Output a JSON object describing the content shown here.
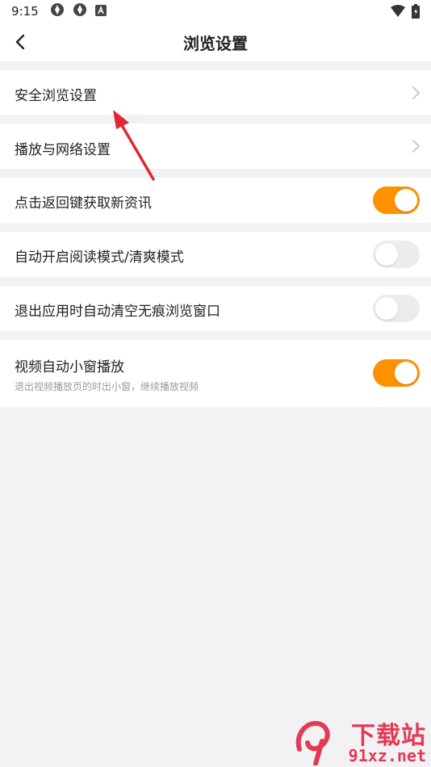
{
  "status_bar": {
    "time": "9:15",
    "icons": [
      "sync-icon",
      "sync-icon",
      "a-icon",
      "wifi-icon",
      "battery-icon"
    ]
  },
  "header": {
    "title": "浏览设置",
    "back_icon": "back-arrow-icon"
  },
  "settings": {
    "safe_browsing": {
      "label": "安全浏览设置"
    },
    "play_network": {
      "label": "播放与网络设置"
    },
    "back_refresh": {
      "label": "点击返回键获取新资讯",
      "enabled": true
    },
    "auto_reader": {
      "label": "自动开启阅读模式/清爽模式",
      "enabled": false
    },
    "clear_incognito": {
      "label": "退出应用时自动清空无痕浏览窗口",
      "enabled": false
    },
    "pip_video": {
      "label": "视频自动小窗播放",
      "sublabel": "退出视频播放页的时出小窗，继续播放视频",
      "enabled": true
    }
  },
  "colors": {
    "accent": "#ff9100",
    "annotation_arrow": "#e0262f",
    "watermark": "#e23a55"
  },
  "watermark": {
    "title": "下载站",
    "url": "91xz.net"
  }
}
